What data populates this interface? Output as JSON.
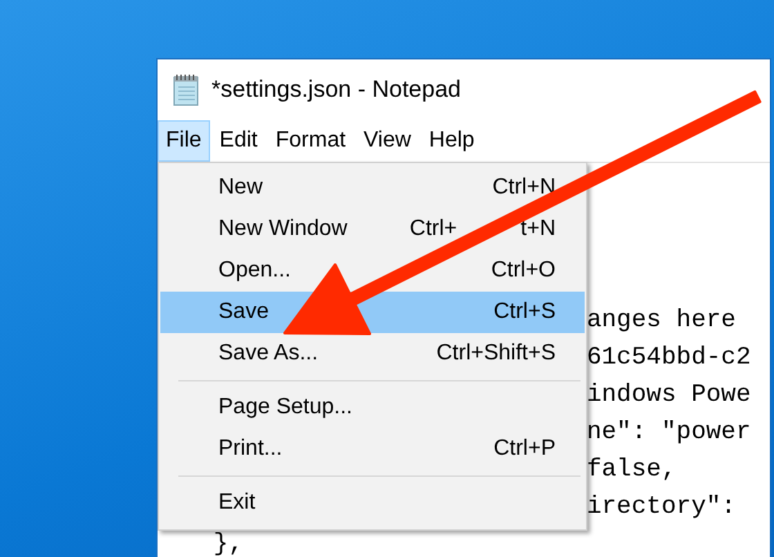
{
  "window": {
    "title": "*settings.json - Notepad"
  },
  "menu_bar": [
    {
      "label": "File",
      "selected": true
    },
    {
      "label": "Edit",
      "selected": false
    },
    {
      "label": "Format",
      "selected": false
    },
    {
      "label": "View",
      "selected": false
    },
    {
      "label": "Help",
      "selected": false
    }
  ],
  "file_menu": {
    "items": [
      {
        "kind": "item",
        "label": "New",
        "shortcut": "Ctrl+N",
        "selected": false
      },
      {
        "kind": "item",
        "label": "New Window",
        "shortcut_parts": [
          "Ctrl+",
          "t+N"
        ],
        "selected": false
      },
      {
        "kind": "item",
        "label": "Open...",
        "shortcut": "Ctrl+O",
        "selected": false
      },
      {
        "kind": "item",
        "label": "Save",
        "shortcut": "Ctrl+S",
        "selected": true
      },
      {
        "kind": "item",
        "label": "Save As...",
        "shortcut": "Ctrl+Shift+S",
        "selected": false
      },
      {
        "kind": "separator"
      },
      {
        "kind": "item",
        "label": "Page Setup...",
        "selected": false
      },
      {
        "kind": "item",
        "label": "Print...",
        "shortcut": "Ctrl+P",
        "selected": false
      },
      {
        "kind": "separator"
      },
      {
        "kind": "item",
        "label": "Exit",
        "selected": false
      }
    ]
  },
  "editor": {
    "lines": [
      "                            anges here",
      "                            61c54bbd-c2",
      "                            indows Powe",
      "                            ne\": \"power",
      "                            false,",
      "                            irectory\":",
      "   },"
    ]
  }
}
